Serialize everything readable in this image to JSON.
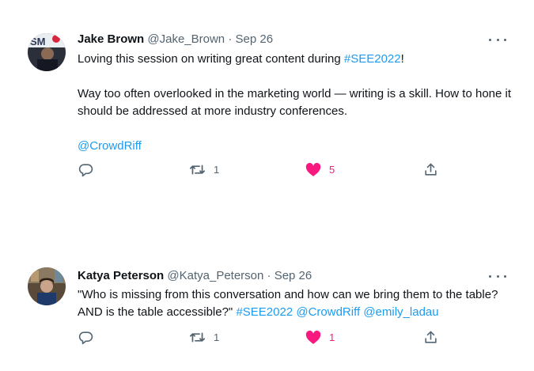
{
  "tweets": [
    {
      "author_name": "Jake Brown",
      "handle": "@Jake_Brown",
      "sep": "·",
      "date": "Sep 26",
      "lines": [
        {
          "pre": "Loving this session on writing great content during ",
          "hashtag": "#SEE2022",
          "post": "!"
        },
        {
          "text": "Way too often overlooked in the marketing world — writing is a skill. How to hone it should be addressed at more industry conferences."
        },
        {
          "mention": "@CrowdRiff"
        }
      ],
      "retweets": "1",
      "likes": "5"
    },
    {
      "author_name": "Katya Peterson",
      "handle": "@Katya_Peterson",
      "sep": "·",
      "date": "Sep 26",
      "text": "\"Who is missing from this conversation and how can we bring them to the table? AND is the table accessible?\"",
      "hashtag": "#SEE2022",
      "mention1": "@CrowdRiff",
      "mention2": "@emily_ladau",
      "retweets": "1",
      "likes": "1"
    }
  ],
  "colors": {
    "link": "#1d9bf0",
    "like": "#f91880",
    "muted": "#536471"
  },
  "icons": [
    "reply-icon",
    "retweet-icon",
    "like-icon",
    "share-icon",
    "more-icon"
  ]
}
